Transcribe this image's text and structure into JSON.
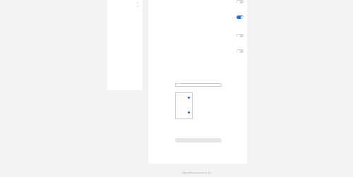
{
  "sidebar": {
    "items": [
      {
        "label": ""
      },
      {
        "label": ""
      },
      {
        "label": ""
      },
      {
        "label": ""
      },
      {
        "label": ""
      },
      {
        "label": ""
      },
      {
        "label": ""
      },
      {
        "label": ""
      },
      {
        "label": ""
      },
      {
        "label": ""
      },
      {
        "label": ""
      },
      {
        "label": ""
      },
      {
        "label": ""
      }
    ]
  },
  "settings": [
    {
      "title": "",
      "desc": "",
      "on": false
    },
    {
      "title": "",
      "desc": "",
      "on": true
    },
    {
      "title": "",
      "desc": "",
      "on": false
    },
    {
      "title": "",
      "desc": "",
      "on": false
    }
  ],
  "style_section": {
    "title": "",
    "desc": "",
    "more_link": "",
    "select_label": "",
    "select_value": "",
    "radio_1": "",
    "radio_2": "",
    "row_1_key": "",
    "row_1_value": "",
    "row_2_key": "",
    "row_2_value": "",
    "apply_label": ""
  },
  "bottom_section": {
    "title": "",
    "desc": "",
    "more_link": ""
  },
  "footer": {
    "links": [
      "",
      "",
      ""
    ],
    "copyright": [
      "",
      "",
      "©2017-2025 Huawei Device Co., Ltd."
    ]
  },
  "colors": {
    "accent": "#1e6cf0",
    "toggle_off": "#d9d9d9",
    "background": "#f2f2f2"
  }
}
